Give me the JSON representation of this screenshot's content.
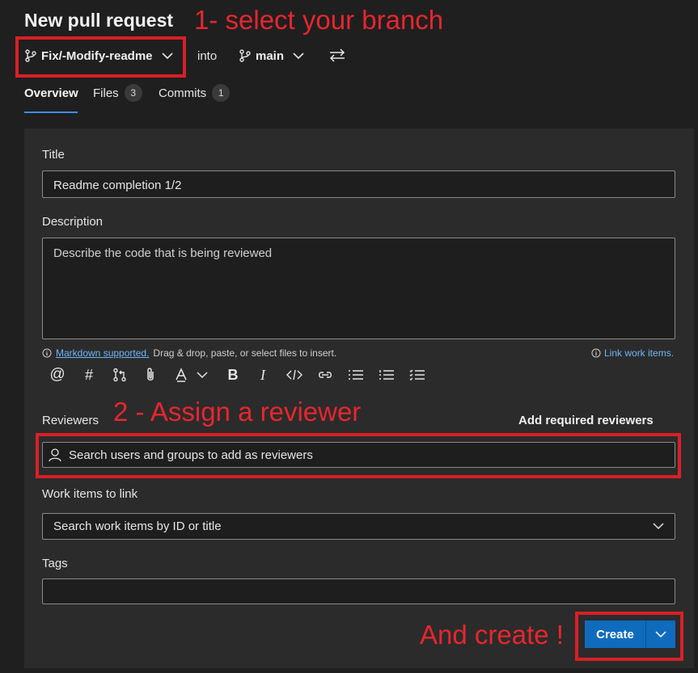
{
  "header": {
    "title": "New pull request",
    "source_branch": "Fix/-Modify-readme",
    "into_label": "into",
    "target_branch": "main"
  },
  "tabs": [
    {
      "label": "Overview",
      "count": ""
    },
    {
      "label": "Files",
      "count": "3"
    },
    {
      "label": "Commits",
      "count": "1"
    }
  ],
  "annotations": {
    "step1": "1- select your branch",
    "step2": "2 - Assign a reviewer",
    "step3": "And create !"
  },
  "form": {
    "title_label": "Title",
    "title_value": "Readme completion 1/2",
    "description_label": "Description",
    "description_placeholder": "Describe the code that is being reviewed",
    "markdown_link": "Markdown supported.",
    "markdown_hint": "Drag & drop, paste, or select files to insert.",
    "link_work_items": "Link work items.",
    "reviewers_label": "Reviewers",
    "add_required_reviewers": "Add required reviewers",
    "reviewers_placeholder": "Search users and groups to add as reviewers",
    "work_items_label": "Work items to link",
    "work_items_placeholder": "Search work items by ID or title",
    "tags_label": "Tags",
    "create_label": "Create"
  },
  "colors": {
    "annotation": "#e8262e",
    "primary": "#0f6cbd",
    "link": "#6cb8f6",
    "active_tab": "#3b8eea"
  }
}
